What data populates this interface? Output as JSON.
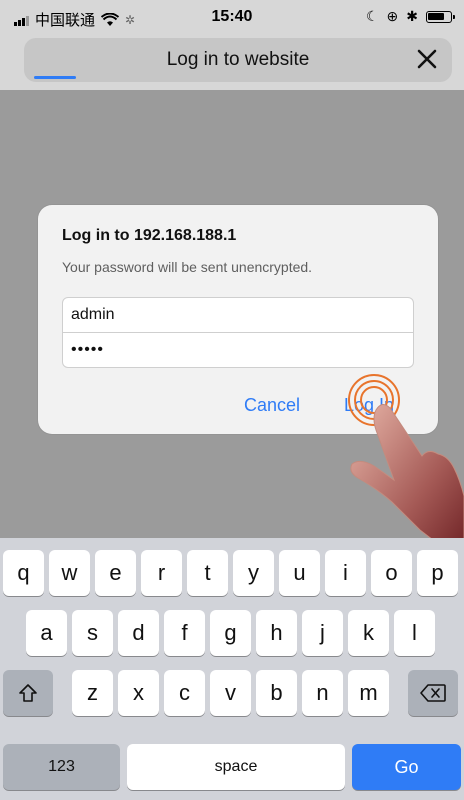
{
  "status": {
    "carrier": "中国联通",
    "time": "15:40"
  },
  "header": {
    "title": "Log in to website",
    "close_icon": "close-icon"
  },
  "dialog": {
    "title": "Log in to 192.168.188.1",
    "subtitle": "Your password will be sent unencrypted.",
    "username_value": "admin",
    "password_value": "•••••",
    "cancel_label": "Cancel",
    "login_label": "Log In"
  },
  "keyboard": {
    "row1": [
      "q",
      "w",
      "e",
      "r",
      "t",
      "y",
      "u",
      "i",
      "o",
      "p"
    ],
    "row2": [
      "a",
      "s",
      "d",
      "f",
      "g",
      "h",
      "j",
      "k",
      "l"
    ],
    "row3": [
      "z",
      "x",
      "c",
      "v",
      "b",
      "n",
      "m"
    ],
    "numbers_label": "123",
    "space_label": "space",
    "go_label": "Go",
    "colors": {
      "accent": "#2f7cf6",
      "touch_ring": "#e8742c"
    }
  }
}
